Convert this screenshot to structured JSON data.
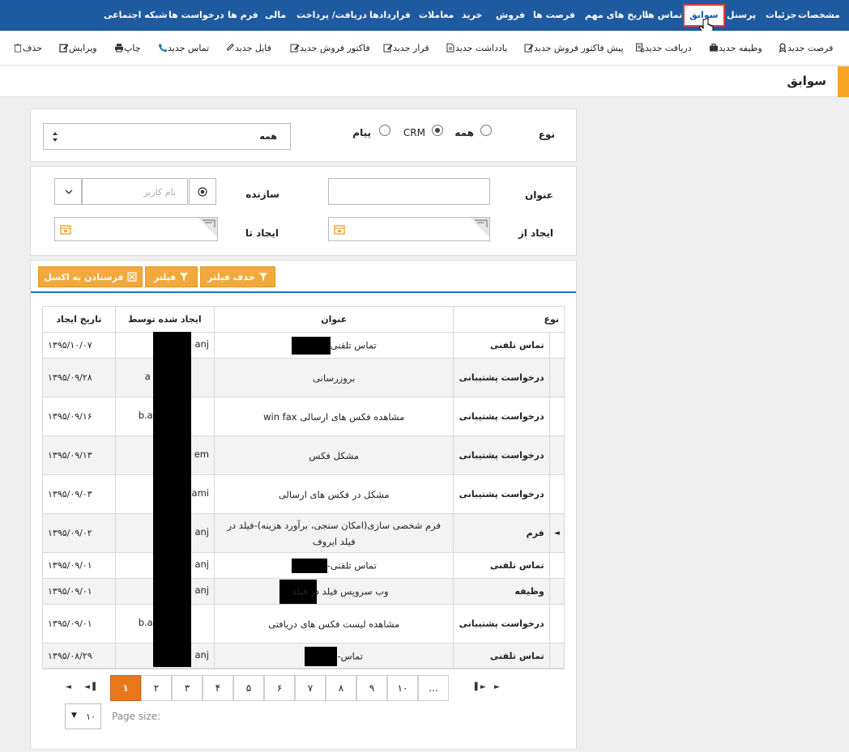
{
  "topnav": {
    "items": [
      "مشخصات",
      "جزئیات",
      "پرسنل",
      "سوابق",
      "تماس ها",
      "تاریخ های مهم",
      "فرصت ها",
      "فروش",
      "خرید",
      "معاملات",
      "قراردادها",
      "دریافت/ پرداخت",
      "مالی",
      "فرم ها",
      "درخواست ها",
      "شبکه اجتماعی"
    ],
    "active": "سوابق"
  },
  "toolbar": {
    "items": [
      "فرصت جدید",
      "وظیفه جدید",
      "دریافت جدید",
      "پیش فاکتور فروش جدید",
      "یادداشت جدید",
      "قرار جدید",
      "فاکتور فروش جدید",
      "فایل جدید",
      "تماس جدید",
      "چاپ",
      "ویرایش",
      "حذف"
    ]
  },
  "page": {
    "title": "سوابق"
  },
  "filter1": {
    "type_label": "نوع",
    "radios": [
      "همه",
      "CRM",
      "پیام"
    ],
    "selected_radio": "CRM",
    "select_value": "همه"
  },
  "filter2": {
    "title_label": "عنوان",
    "creator_label": "سازنده",
    "username_placeholder": "نام کاربر",
    "from_label": "ایجاد از",
    "to_label": "ایجاد تا"
  },
  "buttons": {
    "excel": "فرستادن به اکسل",
    "filter": "فیلتر",
    "clear_filter": "حذف فیلتر"
  },
  "grid": {
    "headers": {
      "type": "نوع",
      "title": "عنوان",
      "by": "ایجاد شده توسط",
      "date": "تاریخ ایجاد"
    },
    "rows": [
      {
        "type": "تماس تلفنی",
        "title": "تماس تلفنی",
        "by": "anj",
        "date": "۱۳۹۵/۱۰/۰۷"
      },
      {
        "type": "درخواست پشتیبانی",
        "title": "بروزرسانی",
        "by": "a var",
        "date": "۱۳۹۵/۰۹/۲۸"
      },
      {
        "type": "درخواست پشتیبانی",
        "title": "مشاهده فکس های ارسالی win fax",
        "by": "b.a deh",
        "date": "۱۳۹۵/۰۹/۱۶"
      },
      {
        "type": "درخواست پشتیبانی",
        "title": "مشکل فکس",
        "by": "em",
        "date": "۱۳۹۵/۰۹/۱۳"
      },
      {
        "type": "درخواست پشتیبانی",
        "title": "مشکل در فکس های ارسالی",
        "by": "ami",
        "date": "۱۳۹۵/۰۹/۰۳"
      },
      {
        "type": "فرم",
        "title": "فرم شخصی سازی(امکان سنجی، برآورد هزینه)-فیلد در فیلد ایروف",
        "by": "anj",
        "date": "۱۳۹۵/۰۹/۰۲"
      },
      {
        "type": "تماس تلفنی",
        "title": "تماس تلفنی-",
        "by": "anj",
        "date": "۱۳۹۵/۰۹/۰۱"
      },
      {
        "type": "وظیفه",
        "title": "وب سرویس فیلد در فیلد",
        "by": "anj",
        "date": "۱۳۹۵/۰۹/۰۱"
      },
      {
        "type": "درخواست پشتیبانی",
        "title": "مشاهده لیست فکس های دریافتی",
        "by": "b.a deh",
        "date": "۱۳۹۵/۰۹/۰۱"
      },
      {
        "type": "تماس تلفنی",
        "title": "تماس-",
        "by": "anj",
        "date": "۱۳۹۵/۰۸/۲۹"
      }
    ]
  },
  "pager": {
    "pages": [
      "۱",
      "۲",
      "۳",
      "۴",
      "۵",
      "۶",
      "۷",
      "۸",
      "۹",
      "۱۰",
      "..."
    ],
    "current": "۱",
    "page_size_label": "Page size:",
    "page_size_value": "۱۰"
  }
}
